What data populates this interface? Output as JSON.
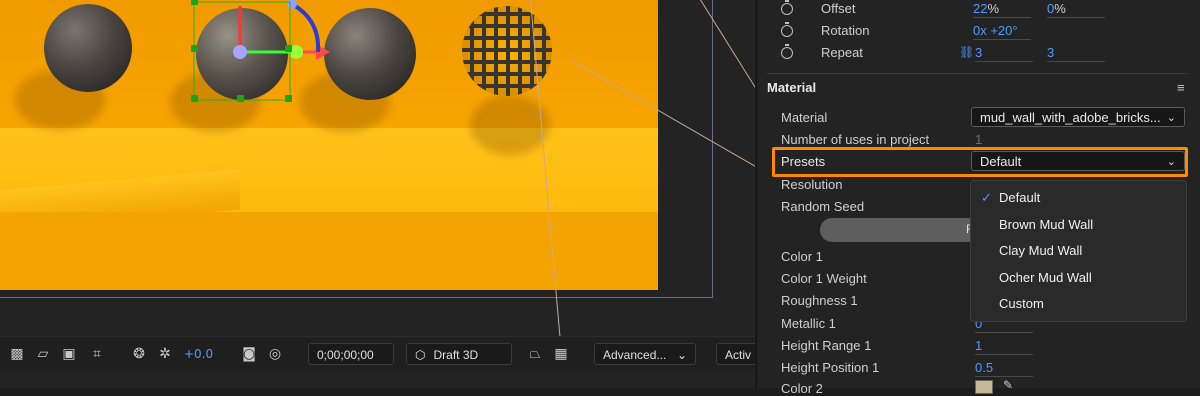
{
  "toolbar": {
    "exposure": "+0.0",
    "timecode": "0;00;00;00",
    "draft3d": "Draft 3D",
    "renderer": "Advanced...",
    "active": "Activ"
  },
  "properties": {
    "offset": {
      "label": "Offset",
      "x": "22",
      "y": "0",
      "unit": "%"
    },
    "rotation": {
      "label": "Rotation",
      "value": "0x +20°"
    },
    "repeat": {
      "label": "Repeat",
      "x": "3",
      "y": "3"
    }
  },
  "material": {
    "section_title": "Material",
    "material_label": "Material",
    "material_value": "mud_wall_with_adobe_bricks...",
    "uses_label": "Number of uses in project",
    "uses_value": "1",
    "presets_label": "Presets",
    "presets_value": "Default",
    "resolution_label": "Resolution",
    "random_seed_label": "Random Seed",
    "button_fragment": "R",
    "color1_label": "Color 1",
    "color1_weight_label": "Color 1 Weight",
    "roughness1_label": "Roughness 1",
    "metallic1_label": "Metallic 1",
    "metallic1_value": "0",
    "height_range1_label": "Height Range 1",
    "height_range1_value": "1",
    "height_position1_label": "Height Position 1",
    "height_position1_value": "0.5",
    "color2_label": "Color 2"
  },
  "presets_menu": {
    "items": [
      "Default",
      "Brown Mud Wall",
      "Clay Mud Wall",
      "Ocher Mud Wall",
      "Custom"
    ],
    "selected": "Default"
  },
  "colors": {
    "accent_blue": "#4d9bff",
    "highlight_orange": "#ff8a00",
    "scene_yellow": "#ffb400"
  }
}
